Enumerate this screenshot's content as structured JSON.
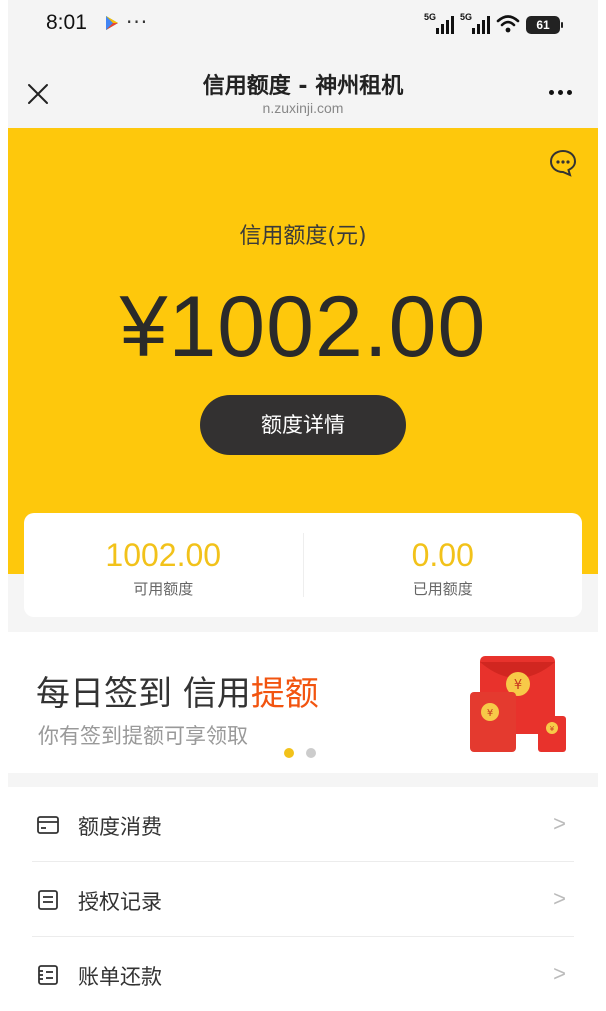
{
  "status_bar": {
    "time": "8:01",
    "more": "···",
    "signal_1": "5G",
    "signal_2": "5G",
    "battery": "61"
  },
  "title_bar": {
    "title": "信用额度 - 神州租机",
    "url": "n.zuxinji.com"
  },
  "hero": {
    "label": "信用额度(元)",
    "amount": "¥1002.00",
    "detail_button": "额度详情"
  },
  "quota": {
    "available_value": "1002.00",
    "available_label": "可用额度",
    "used_value": "0.00",
    "used_label": "已用额度"
  },
  "banner": {
    "title_prefix": "每日签到 信用",
    "title_highlight": "提额",
    "subtitle": "你有签到提额可享领取",
    "dots_active_color": "#f2c21a",
    "dots_inactive_color": "#cccccc"
  },
  "menu": [
    {
      "label": "额度消费",
      "icon": "card-icon"
    },
    {
      "label": "授权记录",
      "icon": "document-icon"
    },
    {
      "label": "账单还款",
      "icon": "bill-icon"
    }
  ],
  "colors": {
    "accent_yellow": "#fec80c",
    "highlight_orange": "#f2540f"
  }
}
